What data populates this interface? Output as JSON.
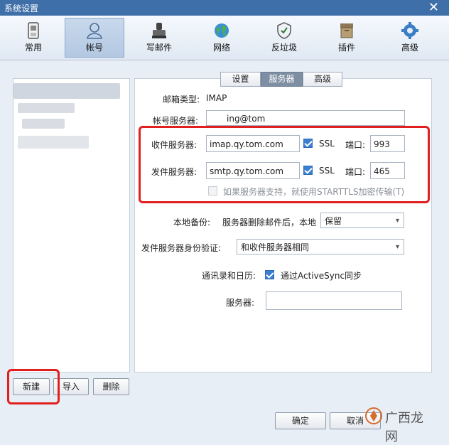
{
  "window": {
    "title": "系统设置",
    "close_glyph": "✕"
  },
  "toolbar": {
    "items": [
      {
        "label": "常用",
        "icon": "phone-icon"
      },
      {
        "label": "帐号",
        "icon": "user-icon"
      },
      {
        "label": "写邮件",
        "icon": "stamp-icon"
      },
      {
        "label": "网络",
        "icon": "globe-icon"
      },
      {
        "label": "反垃圾",
        "icon": "shield-icon"
      },
      {
        "label": "插件",
        "icon": "box-icon"
      },
      {
        "label": "高级",
        "icon": "gear-icon"
      }
    ],
    "active": "帐号"
  },
  "left": {
    "buttons": {
      "new": "新建",
      "import": "导入",
      "delete": "删除"
    }
  },
  "tabs": {
    "settings": "设置",
    "server": "服务器",
    "advanced": "高级",
    "active": "服务器"
  },
  "form": {
    "mail_type_label": "邮箱类型:",
    "mail_type_value": "IMAP",
    "account_server_label": "帐号服务器:",
    "account_server_value": "ing@tom",
    "incoming_label": "收件服务器:",
    "incoming_value": "imap.qy.tom.com",
    "incoming_ssl": "SSL",
    "incoming_port_label": "端口:",
    "incoming_port": "993",
    "outgoing_label": "发件服务器:",
    "outgoing_value": "smtp.qy.tom.com",
    "outgoing_ssl": "SSL",
    "outgoing_port_label": "端口:",
    "outgoing_port": "465",
    "starttls_text": "如果服务器支持，就使用STARTTLS加密传输(T)",
    "backup_label": "本地备份:",
    "backup_desc": "服务器删除邮件后，本地",
    "backup_value": "保留",
    "auth_label": "发件服务器身份验证:",
    "auth_value": "和收件服务器相同",
    "contacts_label": "通讯录和日历:",
    "activesync_text": "通过ActiveSync同步",
    "server_label": "服务器:",
    "server_value": ""
  },
  "footer": {
    "ok": "确定",
    "cancel": "取消"
  },
  "watermark": "广西龙网",
  "colors": {
    "highlight": "#e21f1f",
    "titlebar": "#3f6fa8",
    "checkbox": "#3b7fd0"
  }
}
